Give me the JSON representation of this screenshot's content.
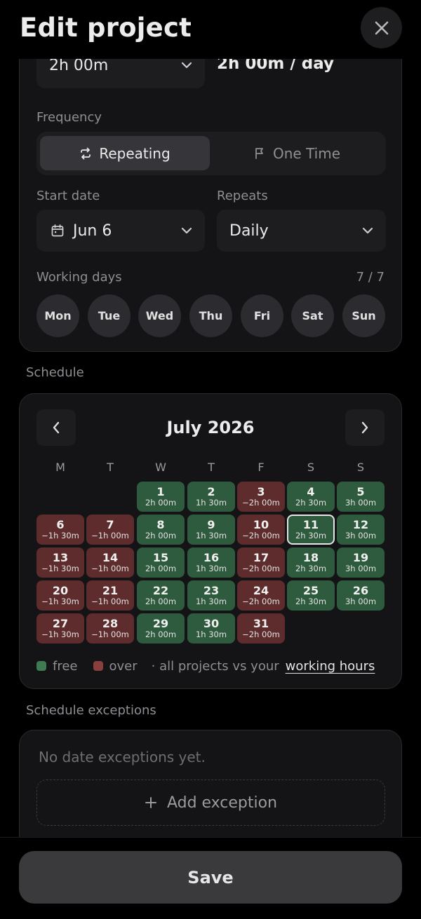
{
  "header": {
    "title": "Edit project"
  },
  "duration": {
    "value": "2h 00m",
    "summary": "2h 00m / day"
  },
  "frequency": {
    "label": "Frequency",
    "options": [
      {
        "label": "Repeating",
        "icon": "repeat-icon",
        "active": true
      },
      {
        "label": "One Time",
        "icon": "flag-icon",
        "active": false
      }
    ]
  },
  "start_date": {
    "label": "Start date",
    "value": "Jun 6"
  },
  "repeats": {
    "label": "Repeats",
    "value": "Daily"
  },
  "working_days": {
    "label": "Working days",
    "count": "7 / 7",
    "days": [
      "Mon",
      "Tue",
      "Wed",
      "Thu",
      "Fri",
      "Sat",
      "Sun"
    ]
  },
  "schedule": {
    "label": "Schedule",
    "month": "July 2026",
    "weekdays": [
      "M",
      "T",
      "W",
      "T",
      "F",
      "S",
      "S"
    ],
    "first_weekday_index": 2,
    "today": 11,
    "days": [
      {
        "day": "1",
        "hours": "2h 00m",
        "status": "free"
      },
      {
        "day": "2",
        "hours": "1h 30m",
        "status": "free"
      },
      {
        "day": "3",
        "hours": "−2h 00m",
        "status": "over"
      },
      {
        "day": "4",
        "hours": "2h 30m",
        "status": "free"
      },
      {
        "day": "5",
        "hours": "3h 00m",
        "status": "free"
      },
      {
        "day": "6",
        "hours": "−1h 30m",
        "status": "over"
      },
      {
        "day": "7",
        "hours": "−1h 00m",
        "status": "over"
      },
      {
        "day": "8",
        "hours": "2h 00m",
        "status": "free"
      },
      {
        "day": "9",
        "hours": "1h 30m",
        "status": "free"
      },
      {
        "day": "10",
        "hours": "−2h 00m",
        "status": "over"
      },
      {
        "day": "11",
        "hours": "2h 30m",
        "status": "free"
      },
      {
        "day": "12",
        "hours": "3h 00m",
        "status": "free"
      },
      {
        "day": "13",
        "hours": "−1h 30m",
        "status": "over"
      },
      {
        "day": "14",
        "hours": "−1h 00m",
        "status": "over"
      },
      {
        "day": "15",
        "hours": "2h 00m",
        "status": "free"
      },
      {
        "day": "16",
        "hours": "1h 30m",
        "status": "free"
      },
      {
        "day": "17",
        "hours": "−2h 00m",
        "status": "over"
      },
      {
        "day": "18",
        "hours": "2h 30m",
        "status": "free"
      },
      {
        "day": "19",
        "hours": "3h 00m",
        "status": "free"
      },
      {
        "day": "20",
        "hours": "−1h 30m",
        "status": "over"
      },
      {
        "day": "21",
        "hours": "−1h 00m",
        "status": "over"
      },
      {
        "day": "22",
        "hours": "2h 00m",
        "status": "free"
      },
      {
        "day": "23",
        "hours": "1h 30m",
        "status": "free"
      },
      {
        "day": "24",
        "hours": "−2h 00m",
        "status": "over"
      },
      {
        "day": "25",
        "hours": "2h 30m",
        "status": "free"
      },
      {
        "day": "26",
        "hours": "3h 00m",
        "status": "free"
      },
      {
        "day": "27",
        "hours": "−1h 30m",
        "status": "over"
      },
      {
        "day": "28",
        "hours": "−1h 00m",
        "status": "over"
      },
      {
        "day": "29",
        "hours": "2h 00m",
        "status": "free"
      },
      {
        "day": "30",
        "hours": "1h 30m",
        "status": "free"
      },
      {
        "day": "31",
        "hours": "−2h 00m",
        "status": "over"
      }
    ],
    "legend": {
      "free": "free",
      "over": "over",
      "note": "· all projects vs your",
      "link": "working hours"
    }
  },
  "exceptions": {
    "label": "Schedule exceptions",
    "empty_text": "No date exceptions yet.",
    "add_label": "Add exception"
  },
  "footer": {
    "save_label": "Save"
  },
  "colors": {
    "background": "#000000",
    "card": "#141416",
    "field": "#1d1d20",
    "free": "#2e5a3e",
    "over": "#5e2c2c",
    "legend_free": "#3e7a52",
    "legend_over": "#8a3e3e"
  }
}
